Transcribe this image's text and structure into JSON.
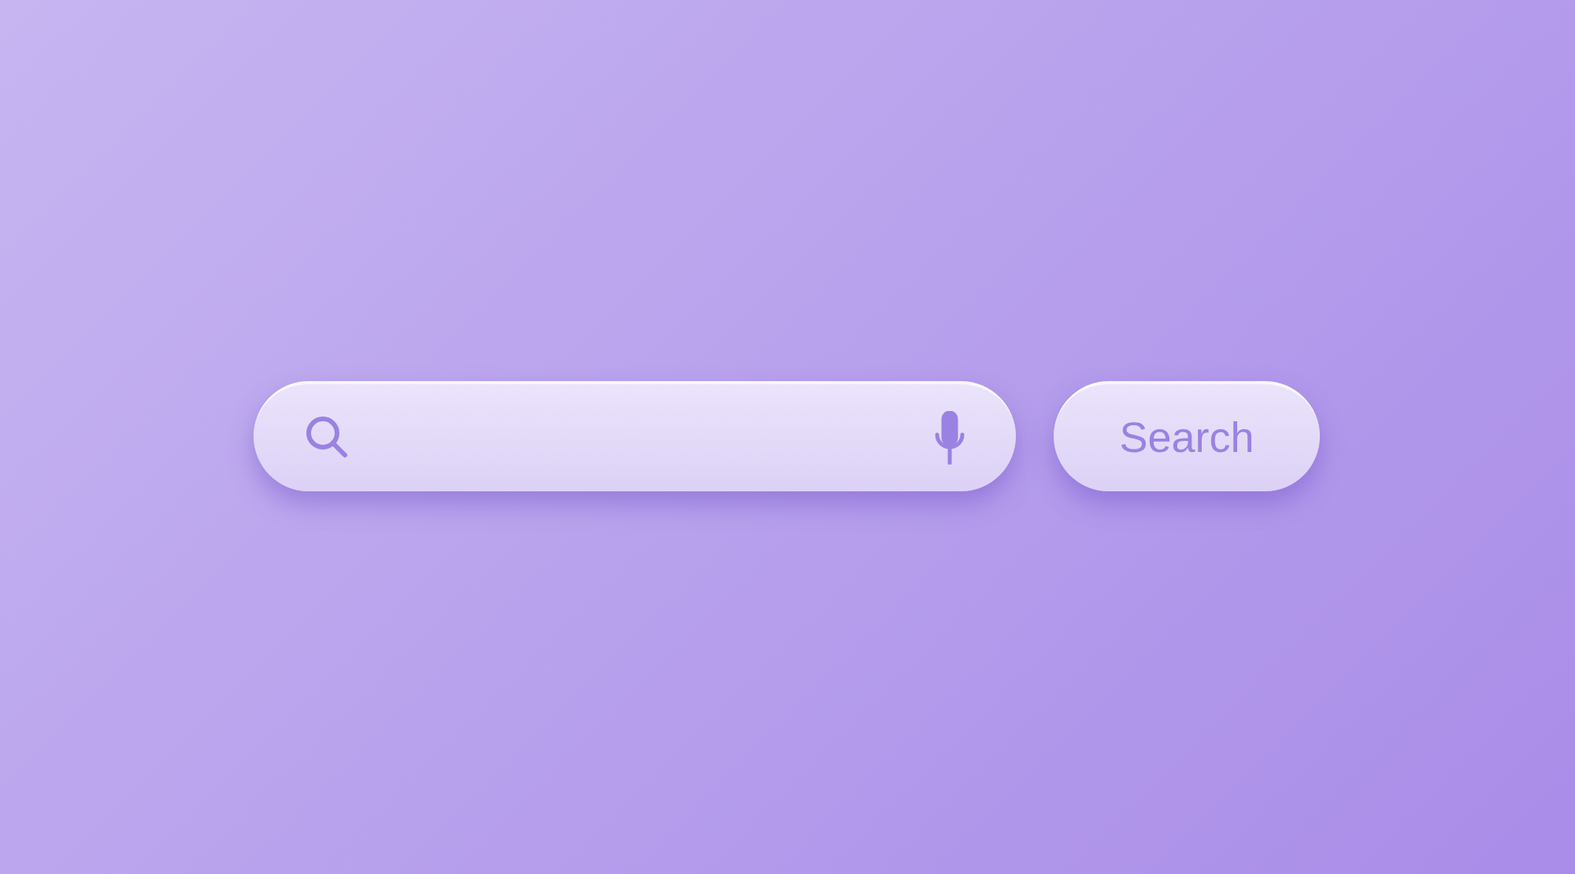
{
  "search_button": {
    "label": "Search"
  }
}
